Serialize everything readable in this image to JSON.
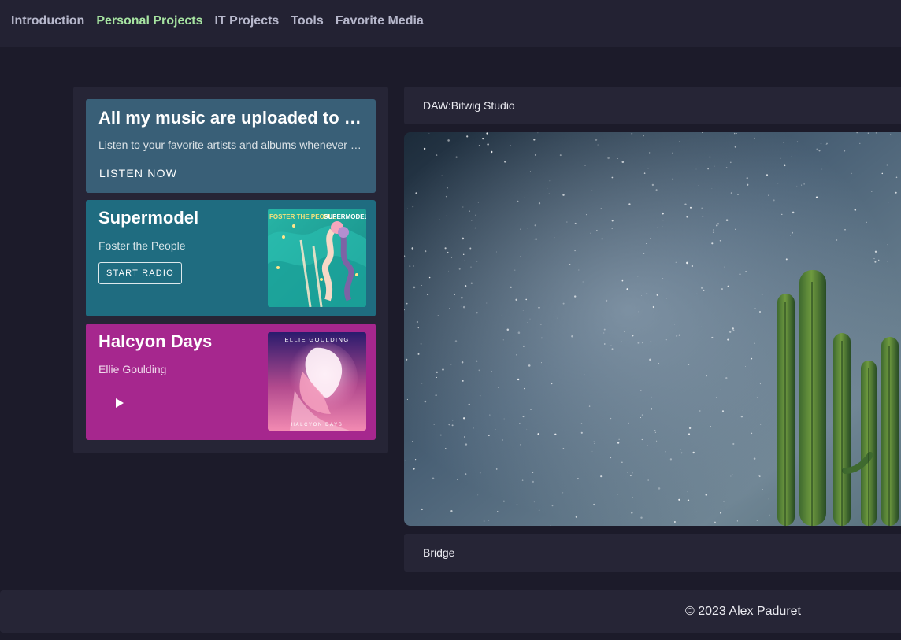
{
  "nav": {
    "items": [
      {
        "label": "Introduction",
        "active": false
      },
      {
        "label": "Personal Projects",
        "active": true
      },
      {
        "label": "IT Projects",
        "active": false
      },
      {
        "label": "Tools",
        "active": false
      },
      {
        "label": "Favorite Media",
        "active": false
      }
    ],
    "active_color": "#a6e3a1",
    "inactive_color": "#b7b8cc"
  },
  "music_panel": {
    "promo": {
      "title": "All my music are uploaded to Spotify",
      "subtitle": "Listen to your favorite artists and albums whenever and wherever",
      "button_label": "LISTEN NOW",
      "color": "#395f77"
    },
    "albums": [
      {
        "title": "Supermodel",
        "artist": "Foster the People",
        "button_label": "START RADIO",
        "art_text_left": "FOSTER THE PEOPLE",
        "art_text_right": "SUPERMODEL",
        "color": "#1f6c80",
        "icon": "album-cover"
      },
      {
        "title": "Halcyon Days",
        "artist": "Ellie Goulding",
        "play_icon": "play-icon",
        "art_text_top": "ELLIE GOULDING",
        "art_text_bottom": "HALCYON DAYS",
        "color": "#a6278e",
        "icon": "album-cover"
      }
    ]
  },
  "media": {
    "header_label": "DAW:Bitwig Studio",
    "image_subject": "starry-sky-with-cactus",
    "footer_label": "Bridge"
  },
  "footer": {
    "copyright": "© 2023 Alex Paduret"
  }
}
